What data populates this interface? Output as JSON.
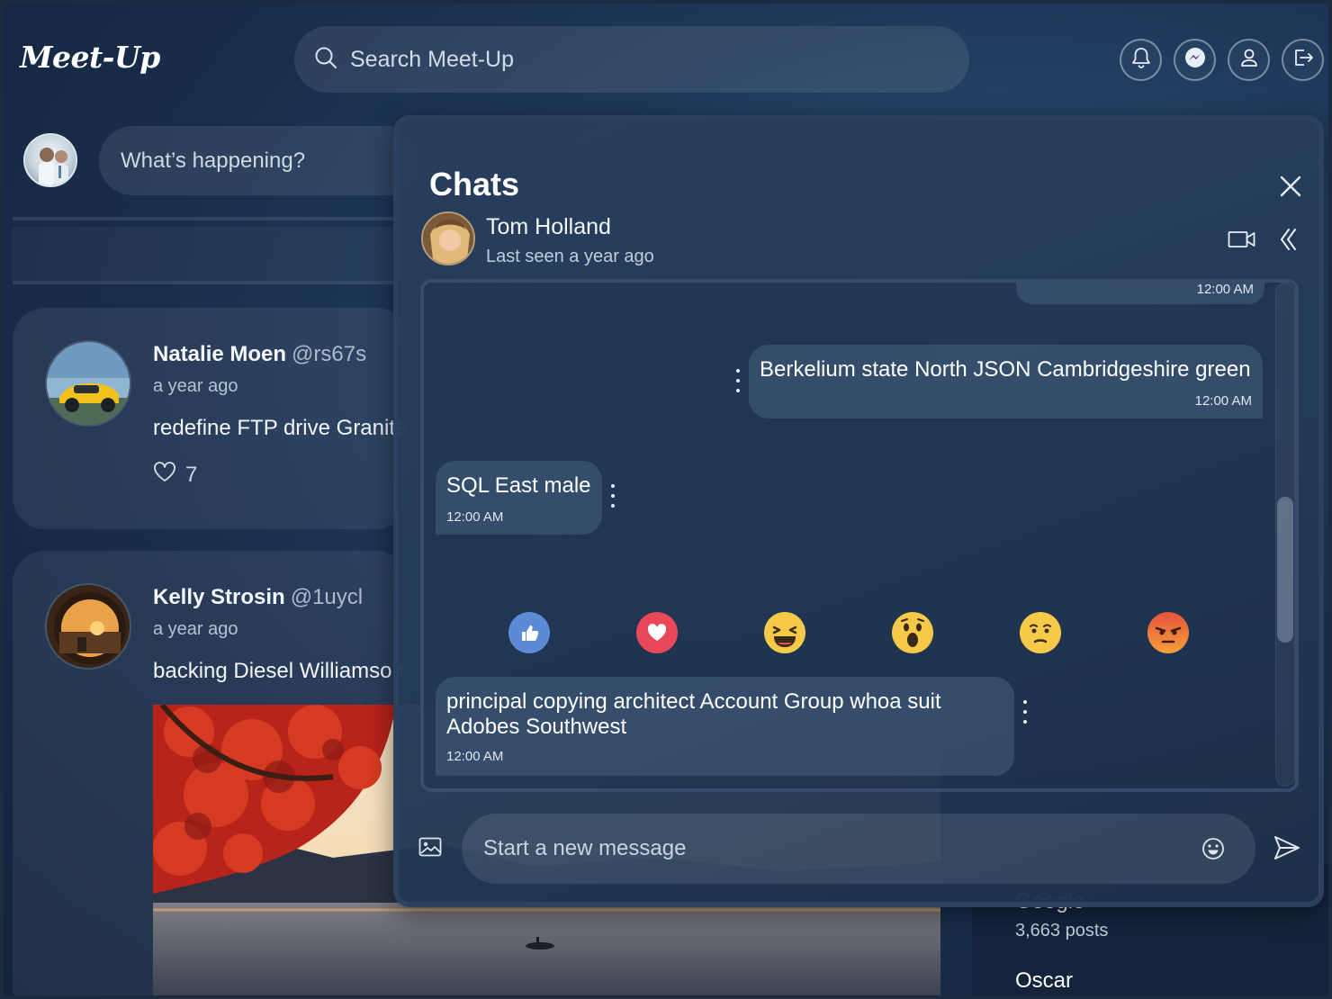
{
  "app": {
    "logo": "Meet-Up"
  },
  "search": {
    "placeholder": "Search Meet-Up"
  },
  "composer": {
    "placeholder": "What’s happening?"
  },
  "posts": [
    {
      "name": "Natalie Moen",
      "handle": "@rs67s",
      "time": "a year ago",
      "text": "redefine FTP drive Granite",
      "likes": "7"
    },
    {
      "name": "Kelly Strosin",
      "handle": "@1uycl",
      "time": "a year ago",
      "text": "backing Diesel Williamson"
    }
  ],
  "trending": [
    {
      "name": "Google",
      "posts": "3,663 posts"
    },
    {
      "name": "Oscar"
    }
  ],
  "chat": {
    "title": "Chats",
    "contact": {
      "name": "Tom Holland",
      "status": "Last seen a year ago"
    },
    "messages": [
      {
        "text": "",
        "time": "12:00 AM",
        "direction": "out"
      },
      {
        "text": "Berkelium state North JSON Cambridgeshire green",
        "time": "12:00 AM",
        "direction": "out"
      },
      {
        "text": "SQL East male",
        "time": "12:00 AM",
        "direction": "in"
      },
      {
        "text": "principal copying architect Account Group whoa suit Adobes Southwest",
        "time": "12:00 AM",
        "direction": "in"
      }
    ],
    "reactions": [
      "like-icon",
      "love-icon",
      "haha-icon",
      "wow-icon",
      "sad-icon",
      "angry-icon"
    ],
    "input_placeholder": "Start a new message"
  },
  "colors": {
    "accent": "#2e5a80",
    "background": "#172a47",
    "like": "#5b8bd6",
    "love": "#e84858",
    "emoji": "#f7c948",
    "angry": "#e6533c"
  }
}
